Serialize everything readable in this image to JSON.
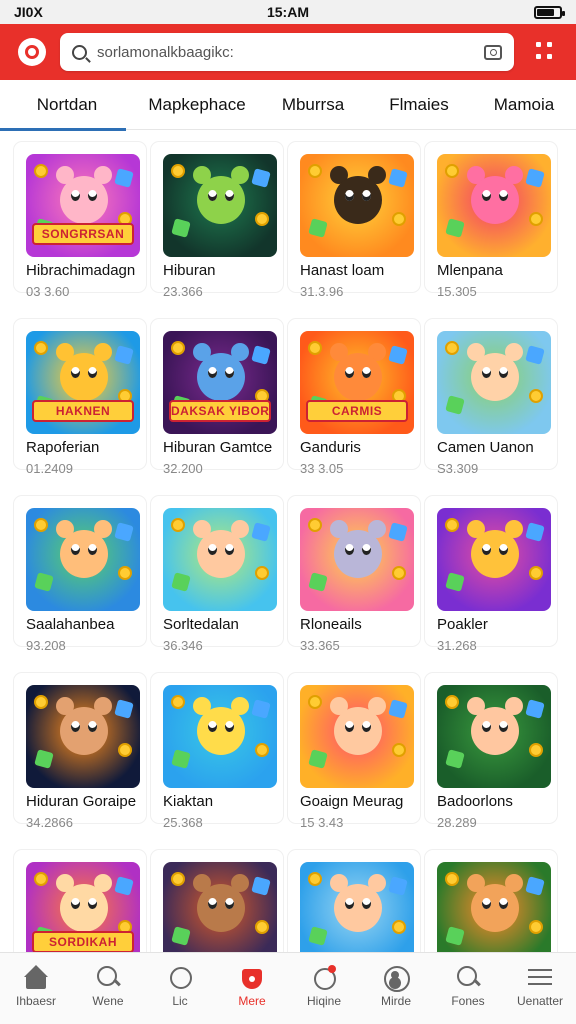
{
  "status_bar": {
    "left": "JI0X",
    "time": "15:AM",
    "battery_level": 0.75
  },
  "header": {
    "search_text": "sorlamonalkbaagikc:",
    "logo_icon": "app-logo-icon",
    "menu_icon": "grid-dots-icon",
    "camera_icon": "camera-icon",
    "brand_color": "#e8302a"
  },
  "tabs": [
    {
      "label": "Nortdan",
      "active": true
    },
    {
      "label": "Mapkephace"
    },
    {
      "label": "Mburrsa"
    },
    {
      "label": "Flmaies"
    },
    {
      "label": "Mamoia"
    }
  ],
  "apps": [
    {
      "title": "Hibrachimadagn",
      "sub": "03 3.60",
      "banner": "SONGRRSAN",
      "bg": "#b637d6",
      "bg2": "#ff7ab8",
      "face": "#ffb6c8"
    },
    {
      "title": "Hiburan",
      "sub": "23.366",
      "banner": "",
      "bg": "#12352b",
      "bg2": "#1e7a4f",
      "face": "#8ed24a"
    },
    {
      "title": "Hanast loam",
      "sub": "31.3.96",
      "banner": "",
      "bg": "#ff8a1f",
      "bg2": "#ffd23a",
      "face": "#3a2a1a"
    },
    {
      "title": "Mlenpana",
      "sub": "15.305",
      "banner": "",
      "bg": "#ffb02e",
      "bg2": "#f23b6a",
      "face": "#ff6fa2"
    },
    {
      "title": "Rapoferian",
      "sub": "01.2409",
      "banner": "HAKNEN",
      "bg": "#1e9ae6",
      "bg2": "#ffcf30",
      "face": "#ffc233"
    },
    {
      "title": "Hiburan Gamtce",
      "sub": "32.200",
      "banner": "DAKSAK YIBORA",
      "bg": "#3a1556",
      "bg2": "#7a2a8e",
      "face": "#5aa2e8"
    },
    {
      "title": "Ganduris",
      "sub": "33 3.05",
      "banner": "CARMIS",
      "bg": "#ff5a1a",
      "bg2": "#ffc02a",
      "face": "#ff8a3a"
    },
    {
      "title": "Camen Uanon",
      "sub": "S3.309",
      "banner": "",
      "bg": "#7ec8ef",
      "bg2": "#8bd16a",
      "face": "#ffd2a8"
    },
    {
      "title": "Saalahanbea",
      "sub": "93.208",
      "banner": "",
      "bg": "#2c8ae0",
      "bg2": "#5ad06a",
      "face": "#ffbe7a"
    },
    {
      "title": "Sorltedalan",
      "sub": "36.346",
      "banner": "",
      "bg": "#46c3ee",
      "bg2": "#b2ea7a",
      "face": "#ffc9a0"
    },
    {
      "title": "Rloneails",
      "sub": "33.365",
      "banner": "",
      "bg": "#f66aa2",
      "bg2": "#ffd34a",
      "face": "#b9b6d8"
    },
    {
      "title": "Poakler",
      "sub": "31.268",
      "banner": "",
      "bg": "#7a2ed1",
      "bg2": "#e64ea0",
      "face": "#ffc23a"
    },
    {
      "title": "Hiduran Goraipe",
      "sub": "34.2866",
      "banner": "",
      "bg": "#101a3a",
      "bg2": "#ff8d1a",
      "face": "#e3a170"
    },
    {
      "title": "Kiaktan",
      "sub": "25.368",
      "banner": "",
      "bg": "#2ba2ee",
      "bg2": "#39c8e6",
      "face": "#ffdc4a"
    },
    {
      "title": "Goaign Meurag",
      "sub": "15 3.43",
      "banner": "",
      "bg": "#ffb028",
      "bg2": "#ff4e70",
      "face": "#ffc9a0"
    },
    {
      "title": "Badoorlons",
      "sub": "28.289",
      "banner": "",
      "bg": "#1a5e2a",
      "bg2": "#3a9a3e",
      "face": "#ffc7a0"
    },
    {
      "title": "",
      "sub": "",
      "banner": "SORDIKAH",
      "bg": "#b030c4",
      "bg2": "#ff7a3a",
      "face": "#ffd9a4"
    },
    {
      "title": "",
      "sub": "",
      "banner": "",
      "bg": "#3b2a58",
      "bg2": "#d65a2a",
      "face": "#b97a4a"
    },
    {
      "title": "",
      "sub": "",
      "banner": "",
      "bg": "#2ea0ea",
      "bg2": "#9ad6f2",
      "face": "#ffc9a0"
    },
    {
      "title": "",
      "sub": "",
      "banner": "",
      "bg": "#2a7a2a",
      "bg2": "#ff8a2a",
      "face": "#f2a35a"
    }
  ],
  "bottom_nav": [
    {
      "label": "Ihbaesr",
      "icon": "home-icon"
    },
    {
      "label": "Wene",
      "icon": "search-icon"
    },
    {
      "label": "Lic",
      "icon": "ring-icon"
    },
    {
      "label": "Mere",
      "icon": "tag-icon",
      "active": true
    },
    {
      "label": "Hiqine",
      "icon": "bell-icon"
    },
    {
      "label": "Mirde",
      "icon": "user-icon"
    },
    {
      "label": "Fones",
      "icon": "search-icon"
    },
    {
      "label": "Uenatter",
      "icon": "menu-icon"
    }
  ]
}
